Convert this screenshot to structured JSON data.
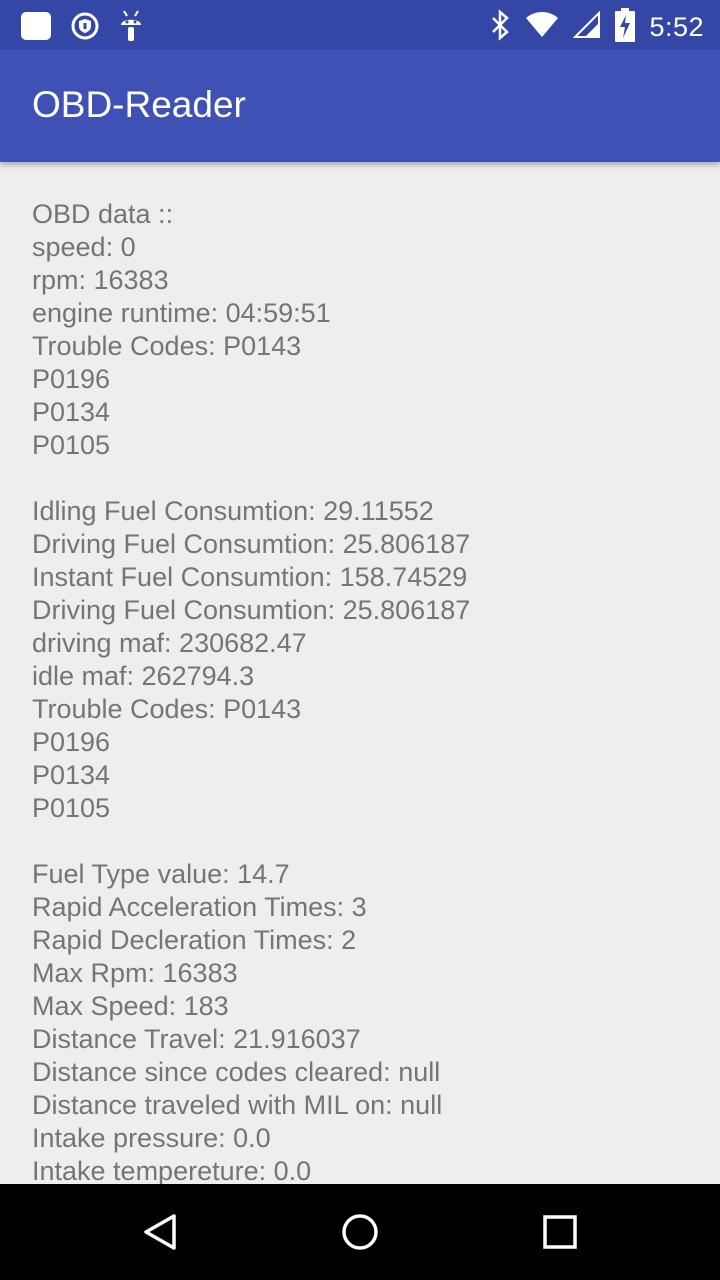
{
  "status_bar": {
    "time": "5:52",
    "left_icons": [
      "square-notification-icon",
      "shield-vpn-icon",
      "android-debug-icon"
    ],
    "right_icons": [
      "bluetooth-icon",
      "wifi-icon",
      "cell-signal-icon",
      "battery-charging-icon"
    ]
  },
  "app_bar": {
    "title": "OBD-Reader",
    "color": "#3f51b5",
    "status_color": "#3447a6"
  },
  "content": {
    "text_color": "#757575",
    "lines": [
      "OBD data ::",
      "speed: 0",
      "rpm: 16383",
      "engine runtime: 04:59:51",
      "Trouble Codes: P0143",
      "P0196",
      "P0134",
      "P0105",
      "",
      "Idling Fuel Consumtion: 29.11552",
      "Driving Fuel Consumtion: 25.806187",
      "Instant Fuel Consumtion: 158.74529",
      "Driving Fuel Consumtion: 25.806187",
      "driving maf: 230682.47",
      "idle maf: 262794.3",
      "Trouble Codes: P0143",
      "P0196",
      "P0134",
      "P0105",
      "",
      "Fuel Type value: 14.7",
      "Rapid Acceleration Times: 3",
      "Rapid Decleration Times: 2",
      "Max Rpm: 16383",
      "Max Speed: 183",
      "Distance Travel: 21.916037",
      "Distance since codes cleared: null",
      "Distance traveled with MIL on: null",
      "Intake pressure: 0.0",
      "Intake tempereture: 0.0"
    ]
  },
  "nav_bar": {
    "buttons": [
      "back-icon",
      "home-icon",
      "recents-icon"
    ]
  }
}
